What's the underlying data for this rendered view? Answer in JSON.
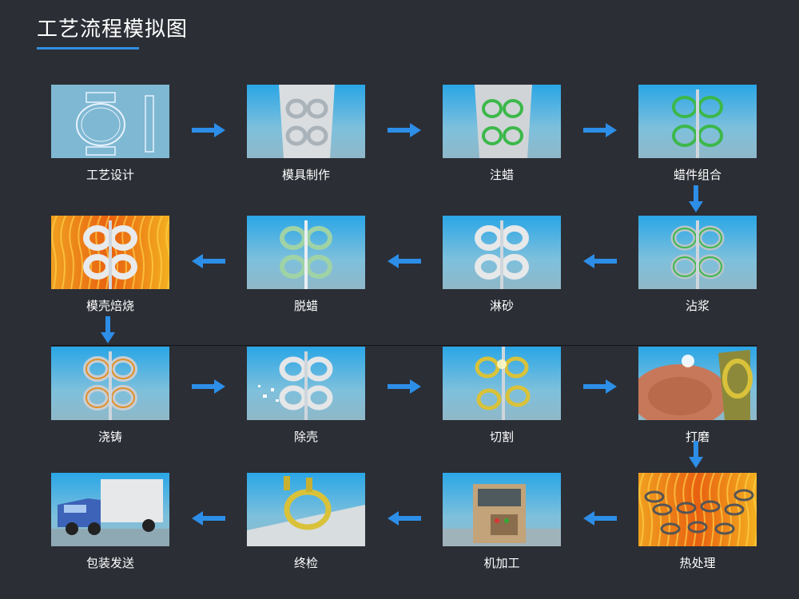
{
  "page": {
    "title": "工艺流程模拟图"
  },
  "steps": [
    {
      "label": "工艺设计",
      "scene": "design"
    },
    {
      "label": "模具制作",
      "scene": "mold"
    },
    {
      "label": "注蜡",
      "scene": "wax"
    },
    {
      "label": "蜡件组合",
      "scene": "waxtree"
    },
    {
      "label": "沾浆",
      "scene": "slurry"
    },
    {
      "label": "淋砂",
      "scene": "sand"
    },
    {
      "label": "脱蜡",
      "scene": "dewax"
    },
    {
      "label": "模壳焙烧",
      "scene": "fire"
    },
    {
      "label": "浇铸",
      "scene": "pour"
    },
    {
      "label": "除壳",
      "scene": "shell"
    },
    {
      "label": "切割",
      "scene": "cut"
    },
    {
      "label": "打磨",
      "scene": "grind"
    },
    {
      "label": "热处理",
      "scene": "heat"
    },
    {
      "label": "机加工",
      "scene": "machine"
    },
    {
      "label": "终检",
      "scene": "inspect"
    },
    {
      "label": "包装发送",
      "scene": "truck"
    }
  ],
  "colors": {
    "background": "#2b2e35",
    "accent": "#2f8fe0",
    "arrow": "#2d8ee8",
    "sky_top": "#2aa6e6",
    "sky_bottom": "#8fb8c8",
    "wax_green": "#3cb84a",
    "casting_gold": "#d9c23a",
    "fire": "#e8801e"
  }
}
